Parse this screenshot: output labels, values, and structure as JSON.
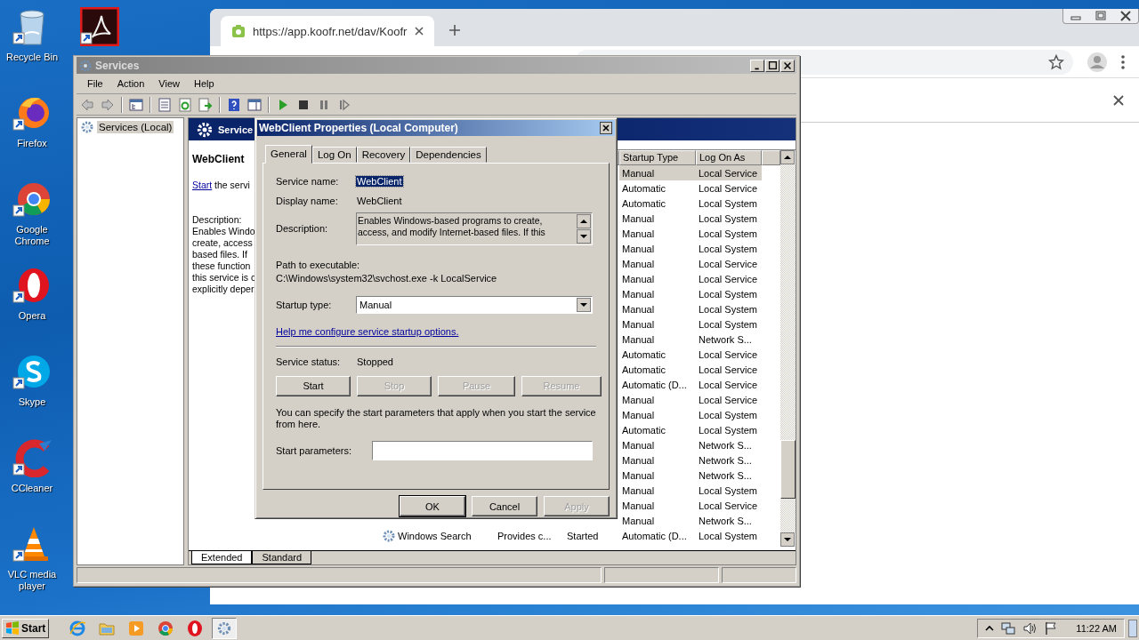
{
  "desktop": {
    "shortcut": {
      "kind": "acrobat"
    },
    "icons": [
      {
        "kind": "recycle",
        "label": "Recycle Bin"
      },
      {
        "kind": "firefox",
        "label": "Firefox"
      },
      {
        "kind": "chrome",
        "label": "Google Chrome"
      },
      {
        "kind": "opera",
        "label": "Opera"
      },
      {
        "kind": "skype",
        "label": "Skype"
      },
      {
        "kind": "ccleaner",
        "label": "CCleaner"
      },
      {
        "kind": "vlc",
        "label": "VLC media player"
      }
    ]
  },
  "browser": {
    "tab": {
      "title": "https://app.koofr.net/dav/Koofr"
    }
  },
  "services": {
    "title": "Services",
    "menu": [
      "File",
      "Action",
      "View",
      "Help"
    ],
    "tree": [
      {
        "label": "Services (Local)",
        "selected": true
      }
    ],
    "header": "Service",
    "selected_service": "WebClient",
    "action": {
      "link": "Start",
      "rest": " the servi"
    },
    "description_label": "Description:",
    "description_lines": [
      "Enables Windo",
      "create, access",
      "based files. If",
      "these function",
      "this service is c",
      "explicitly deper"
    ],
    "columns": [
      "Startup Type",
      "Log On As"
    ],
    "rows": [
      {
        "startup": "Manual",
        "logon": "Local Service",
        "selected": true
      },
      {
        "startup": "Automatic",
        "logon": "Local Service",
        "selected": false
      },
      {
        "startup": "Automatic",
        "logon": "Local System",
        "selected": false
      },
      {
        "startup": "Manual",
        "logon": "Local System",
        "selected": false
      },
      {
        "startup": "Manual",
        "logon": "Local System",
        "selected": false
      },
      {
        "startup": "Manual",
        "logon": "Local System",
        "selected": false
      },
      {
        "startup": "Manual",
        "logon": "Local Service",
        "selected": false
      },
      {
        "startup": "Manual",
        "logon": "Local Service",
        "selected": false
      },
      {
        "startup": "Manual",
        "logon": "Local System",
        "selected": false
      },
      {
        "startup": "Manual",
        "logon": "Local System",
        "selected": false
      },
      {
        "startup": "Manual",
        "logon": "Local System",
        "selected": false
      },
      {
        "startup": "Manual",
        "logon": "Network S...",
        "selected": false
      },
      {
        "startup": "Automatic",
        "logon": "Local Service",
        "selected": false
      },
      {
        "startup": "Automatic",
        "logon": "Local Service",
        "selected": false
      },
      {
        "startup": "Automatic (D...",
        "logon": "Local Service",
        "selected": false
      },
      {
        "startup": "Manual",
        "logon": "Local Service",
        "selected": false
      },
      {
        "startup": "Manual",
        "logon": "Local System",
        "selected": false
      },
      {
        "startup": "Automatic",
        "logon": "Local System",
        "selected": false
      },
      {
        "startup": "Manual",
        "logon": "Network S...",
        "selected": false
      },
      {
        "startup": "Manual",
        "logon": "Network S...",
        "selected": false
      },
      {
        "startup": "Manual",
        "logon": "Network S...",
        "selected": false
      },
      {
        "startup": "Manual",
        "logon": "Local System",
        "selected": false
      },
      {
        "startup": "Manual",
        "logon": "Local Service",
        "selected": false
      },
      {
        "startup": "Manual",
        "logon": "Network S...",
        "selected": false
      }
    ],
    "last_row": {
      "name": "Windows Search",
      "description": "Provides c...",
      "status": "Started",
      "startup": "Automatic (D...",
      "logon": "Local System",
      "selected": false
    },
    "view_tabs": [
      {
        "label": "Extended",
        "selected": true
      },
      {
        "label": "Standard",
        "selected": false
      }
    ]
  },
  "dialog": {
    "title": "WebClient Properties (Local Computer)",
    "tabs": [
      {
        "label": "General",
        "selected": true
      },
      {
        "label": "Log On",
        "selected": false
      },
      {
        "label": "Recovery",
        "selected": false
      },
      {
        "label": "Dependencies",
        "selected": false
      }
    ],
    "service_name": {
      "label": "Service name:",
      "value": "WebClient",
      "highlighted": true
    },
    "display_name": {
      "label": "Display name:",
      "value": "WebClient"
    },
    "description": {
      "label": "Description:",
      "lines": [
        "Enables Windows-based programs to create,",
        "access, and modify Internet-based files. If this"
      ]
    },
    "path": {
      "label": "Path to executable:",
      "value": "C:\\Windows\\system32\\svchost.exe -k LocalService"
    },
    "startup_type": {
      "label": "Startup type:",
      "value": "Manual"
    },
    "help_link": "Help me configure service startup options.",
    "status": {
      "label": "Service status:",
      "value": "Stopped"
    },
    "control_buttons": [
      {
        "label": "Start",
        "disabled": false
      },
      {
        "label": "Stop",
        "disabled": true
      },
      {
        "label": "Pause",
        "disabled": true
      },
      {
        "label": "Resume",
        "disabled": true
      }
    ],
    "note": "You can specify the start parameters that apply when you start the service from here.",
    "parameters": {
      "label": "Start parameters:"
    },
    "buttons": [
      {
        "label": "OK",
        "default": true,
        "disabled": false
      },
      {
        "label": "Cancel",
        "default": false,
        "disabled": false
      },
      {
        "label": "Apply",
        "default": false,
        "disabled": true
      }
    ]
  },
  "taskbar": {
    "start": "Start",
    "apps": [
      {
        "kind": "ie",
        "selected": false
      },
      {
        "kind": "explorer",
        "selected": false
      },
      {
        "kind": "media",
        "selected": false
      },
      {
        "kind": "chrome",
        "selected": false
      },
      {
        "kind": "opera",
        "selected": false
      },
      {
        "kind": "services",
        "selected": true
      }
    ],
    "clock": "11:22 AM"
  }
}
